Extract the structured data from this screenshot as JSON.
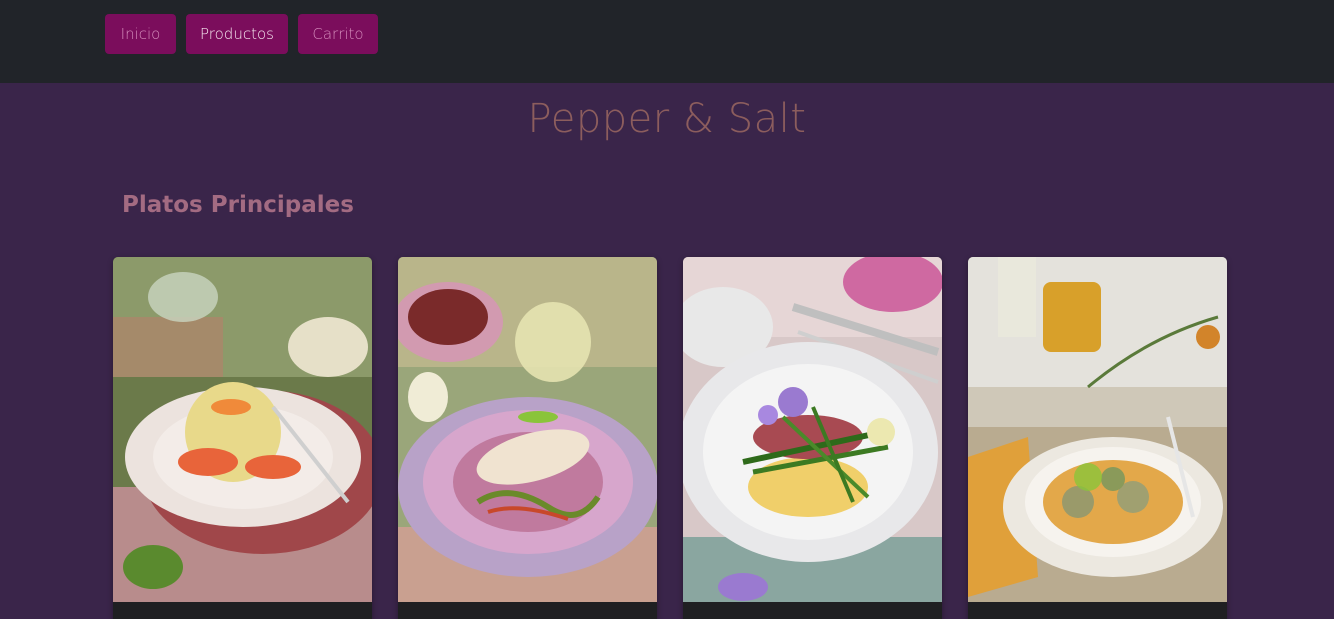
{
  "nav": {
    "items": [
      {
        "label": "Inicio"
      },
      {
        "label": "Productos"
      },
      {
        "label": "Carrito"
      }
    ],
    "active": "Productos",
    "accent": "#7b0d5c",
    "bar_color": "#212429"
  },
  "header": {
    "title": "Pepper & Salt",
    "title_color": "#8c5d5d"
  },
  "section": {
    "title": "Platos Principales"
  },
  "page": {
    "background": "#3a254a"
  },
  "products": [
    {
      "image": "salmon-potato-salad-plate-image"
    },
    {
      "image": "stuffed-squid-vegetables-plate-image"
    },
    {
      "image": "asparagus-scrambled-eggs-plate-image"
    },
    {
      "image": "meatballs-curry-vegetables-plate-image"
    }
  ]
}
